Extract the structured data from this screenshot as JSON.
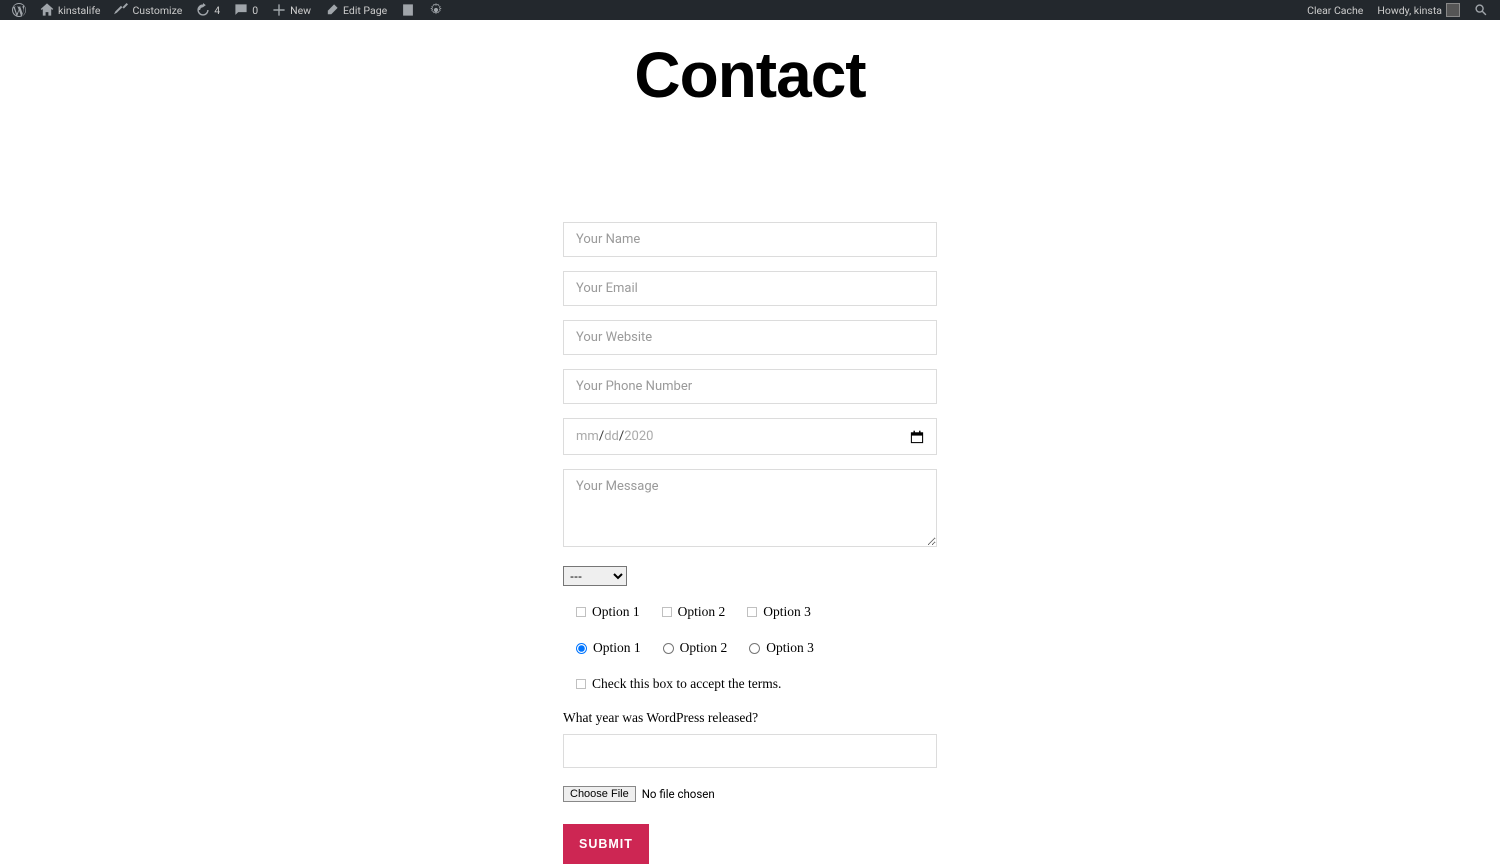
{
  "adminbar": {
    "site_name": "kinstalife",
    "customize": "Customize",
    "revisions": "4",
    "comments": "0",
    "new": "New",
    "edit_page": "Edit Page",
    "clear_cache": "Clear Cache",
    "howdy": "Howdy, kinsta"
  },
  "page": {
    "title": "Contact"
  },
  "form": {
    "name_ph": "Your Name",
    "email_ph": "Your Email",
    "website_ph": "Your Website",
    "phone_ph": "Your Phone Number",
    "date_mm": "mm",
    "date_dd": "dd",
    "date_yyyy": "2020",
    "message_ph": "Your Message",
    "select_default": "---",
    "checkbox_opts": [
      "Option 1",
      "Option 2",
      "Option 3"
    ],
    "radio_opts": [
      "Option 1",
      "Option 2",
      "Option 3"
    ],
    "terms_label": "Check this box to accept the terms.",
    "question": "What year was WordPress released?",
    "choose_file": "Choose File",
    "no_file": "No file chosen",
    "submit": "SUBMIT"
  }
}
